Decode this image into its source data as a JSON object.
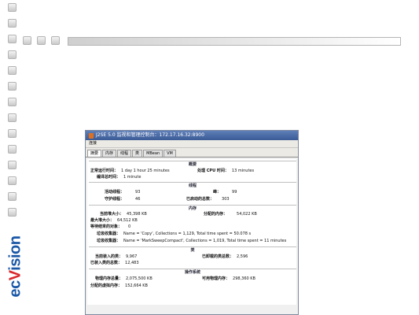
{
  "brand": {
    "part1": "ec",
    "part2": "Vision"
  },
  "window": {
    "title": "J2SE 5.0 监视和管理控制台：172.17.16.32:8900",
    "menu": "连接",
    "tabs": [
      "摘要",
      "内存",
      "线程",
      "类",
      "MBean",
      "VM"
    ],
    "sections": {
      "summary": "概要",
      "threads": "线程",
      "memory": "内存",
      "classes": "类",
      "os": "操作系统"
    },
    "rows": {
      "uptime_label": "正常运行时间：",
      "uptime_value": "1 day 1 hour 25 minutes",
      "cpu_label": "处理 CPU 时间：",
      "cpu_value": "13 minutes",
      "compile_label": "编译总时间：",
      "compile_value": "1 minute",
      "live_threads_label": "活动线程：",
      "live_threads_value": "93",
      "peak_label": "峰：",
      "peak_value": "99",
      "daemon_label": "守护线程：",
      "daemon_value": "46",
      "started_label": "已启动的总数：",
      "started_value": "303",
      "heap_label": "当前堆大小：",
      "heap_value": "45,398 KB",
      "committed_label": "分配的内存：",
      "committed_value": "54,022 KB",
      "max_heap_label": "最大堆大小：",
      "max_heap_value": "64,512 KB",
      "finalize_label": "等待结束的对象：",
      "finalize_value": "0",
      "gc1_label": "垃圾收集器：",
      "gc1_value": "Name = 'Copy', Collections = 1,129, Total time spent = 50.078 s",
      "gc2_label": "垃圾收集器：",
      "gc2_value": "Name = 'MarkSweepCompact', Collections = 1,019, Total time spent = 11 minutes",
      "loaded_label": "当前装入的类：",
      "loaded_value": "9,967",
      "unloaded_label": "已卸载的类总数：",
      "unloaded_value": "2,596",
      "total_loaded_label": "已装入类的总数：",
      "total_loaded_value": "12,483",
      "total_mem_label": "物理内存总量：",
      "total_mem_value": "2,075,500 KB",
      "free_mem_label": "可用物理内存：",
      "free_mem_value": "298,360 KB",
      "swap_label": "分配的虚拟内存：",
      "swap_value": "152,664 KB"
    }
  }
}
